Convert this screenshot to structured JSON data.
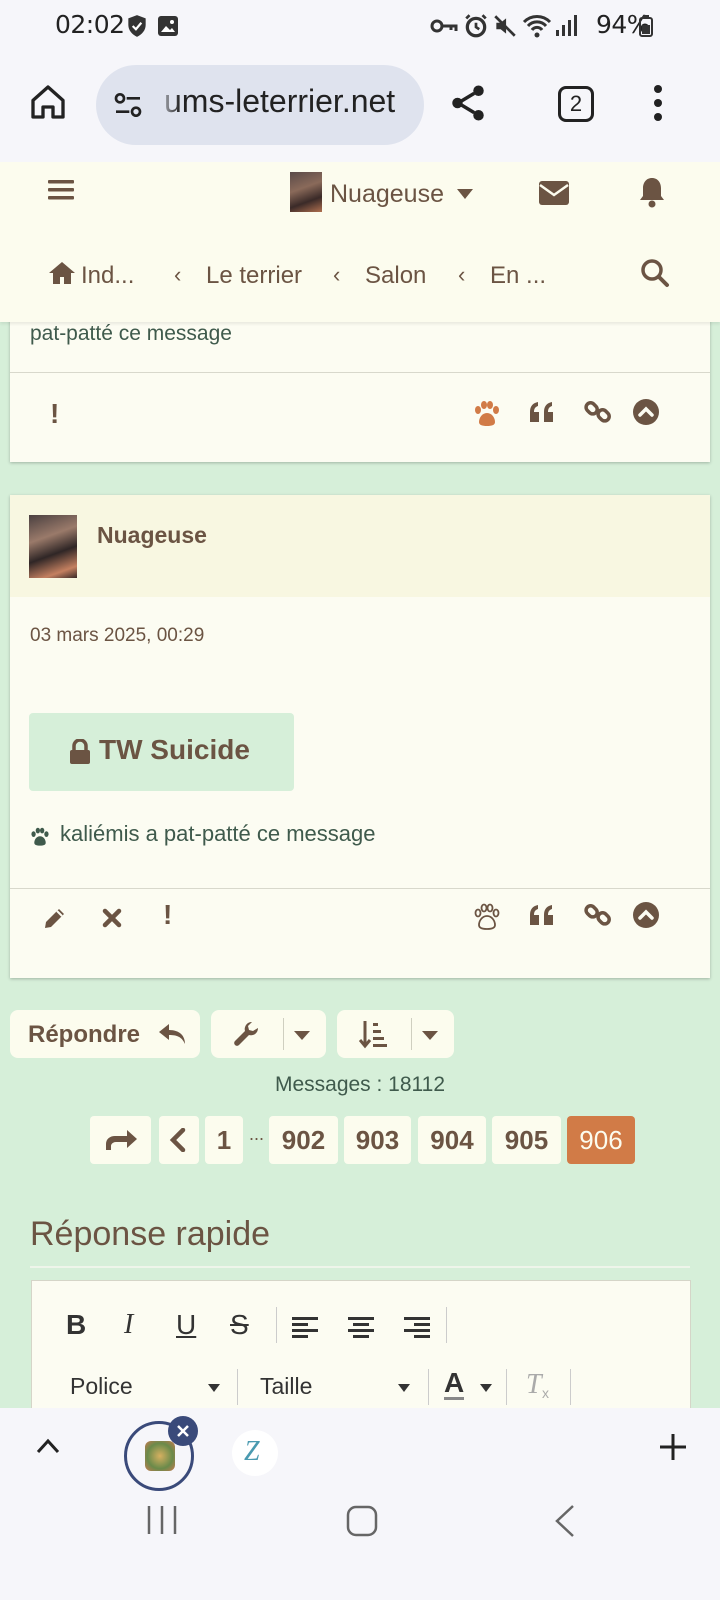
{
  "status": {
    "time": "02:02",
    "battery": "94%"
  },
  "browser": {
    "url": "ums-leterrier.net",
    "tab_count": "2"
  },
  "header": {
    "username": "Nuageuse",
    "breadcrumb": [
      "Ind...",
      "Le terrier",
      "Salon",
      "En ..."
    ]
  },
  "post_prev": {
    "text": "pat-patté ce message"
  },
  "post": {
    "author": "Nuageuse",
    "date": "03 mars 2025, 00:29",
    "spoiler_label": "TW Suicide",
    "reaction_text": "kaliémis a pat-patté ce message"
  },
  "actions": {
    "reply_label": "Répondre"
  },
  "messages_count": "Messages : 18112",
  "pagination": {
    "pages": [
      "1",
      "902",
      "903",
      "904",
      "905",
      "906"
    ],
    "ellipsis": "...",
    "current": "906"
  },
  "quick_reply": {
    "title": "Réponse rapide",
    "font_label": "Police",
    "size_label": "Taille",
    "buttons": [
      "B",
      "I",
      "U",
      "S"
    ]
  },
  "colors": {
    "accent": "#d17b47",
    "brown": "#6b5443",
    "bg": "#d6efd9",
    "card": "#fcfcf2"
  }
}
